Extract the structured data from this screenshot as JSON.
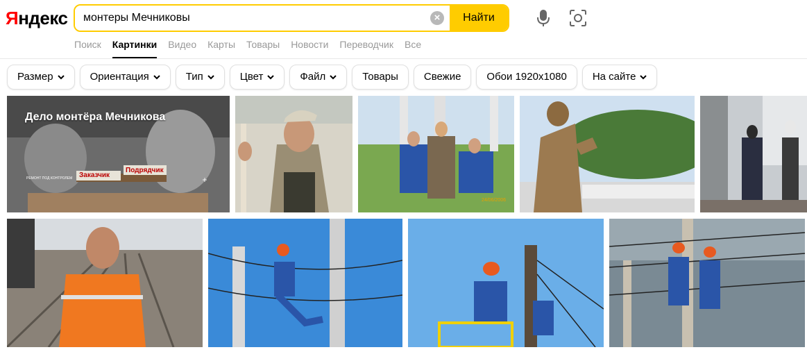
{
  "logo": {
    "first": "Я",
    "rest": "ндекс"
  },
  "search": {
    "query": "монтеры Мечниковы",
    "clear_icon": "×",
    "submit_label": "Найти"
  },
  "tabs": [
    {
      "label": "Поиск",
      "active": false
    },
    {
      "label": "Картинки",
      "active": true
    },
    {
      "label": "Видео",
      "active": false
    },
    {
      "label": "Карты",
      "active": false
    },
    {
      "label": "Товары",
      "active": false
    },
    {
      "label": "Новости",
      "active": false
    },
    {
      "label": "Переводчик",
      "active": false
    },
    {
      "label": "Все",
      "active": false
    }
  ],
  "filters": [
    {
      "label": "Размер",
      "dropdown": true
    },
    {
      "label": "Ориентация",
      "dropdown": true
    },
    {
      "label": "Тип",
      "dropdown": true
    },
    {
      "label": "Цвет",
      "dropdown": true
    },
    {
      "label": "Файл",
      "dropdown": true
    },
    {
      "label": "Товары",
      "dropdown": false
    },
    {
      "label": "Свежие",
      "dropdown": false
    },
    {
      "label": "Обои 1920x1080",
      "dropdown": false
    },
    {
      "label": "На сайте",
      "dropdown": true
    }
  ],
  "results": {
    "r1": {
      "caption": "Дело монтёра Мечникова",
      "label_customer": "Заказчик",
      "label_contractor": "Подрядчик",
      "small_caption": "РЕМОНТ ПОД КОНТРОЛЕМ"
    },
    "r3": {
      "date_stamp": "24/06/2006"
    }
  },
  "colors": {
    "accent": "#ffcc00",
    "logo_red": "#ff0000"
  }
}
